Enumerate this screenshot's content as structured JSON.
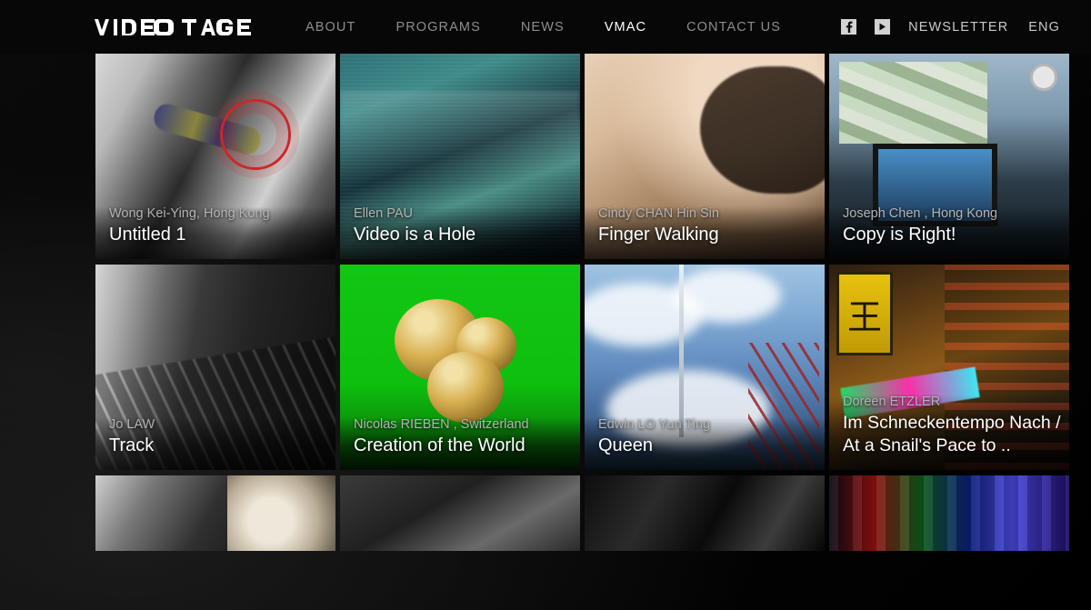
{
  "header": {
    "brand": "VIDEOTAGE",
    "nav": [
      {
        "label": "ABOUT",
        "active": false
      },
      {
        "label": "PROGRAMS",
        "active": false
      },
      {
        "label": "NEWS",
        "active": false
      },
      {
        "label": "VMAC",
        "active": true
      },
      {
        "label": "CONTACT US",
        "active": false
      }
    ],
    "social": [
      {
        "icon": "facebook-icon"
      },
      {
        "icon": "video-play-icon"
      }
    ],
    "newsletter_label": "NEWSLETTER",
    "language_label": "ENG",
    "background": "#070707",
    "active_color": "#ffffff",
    "inactive_color": "#8d8d8d"
  },
  "grid": {
    "rows": [
      {
        "cards": [
          {
            "artist": "Wong Kei-Ying, Hong Kong",
            "title": "Untitled 1",
            "thumb": "t-untitled1"
          },
          {
            "artist": "Ellen PAU",
            "title": "Video is a Hole",
            "thumb": "t-videohole"
          },
          {
            "artist": "Cindy CHAN Hin Sin",
            "title": "Finger Walking",
            "thumb": "t-finger"
          },
          {
            "artist": "Joseph Chen , Hong Kong",
            "title": "Copy is Right!",
            "thumb": "t-copyright"
          }
        ]
      },
      {
        "cards": [
          {
            "artist": "Jo LAW",
            "title": "Track",
            "thumb": "t-track"
          },
          {
            "artist": "Nicolas RIEBEN , Switzerland",
            "title": "Creation of the World",
            "thumb": "t-creation"
          },
          {
            "artist": "Edwin LO Yun Ting",
            "title": "Queen",
            "thumb": "t-queen"
          },
          {
            "artist": "Doreen ETZLER",
            "title": "Im Schneckentempo Nach / At a Snail's Pace to ..",
            "thumb": "t-snail"
          }
        ]
      }
    ]
  }
}
